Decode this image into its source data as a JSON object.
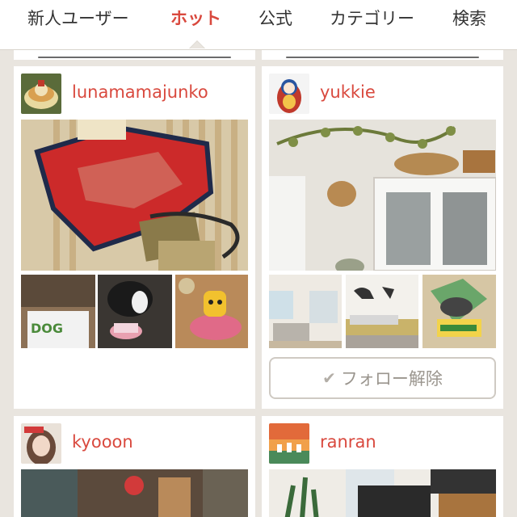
{
  "tabs": [
    {
      "label": "新人ユーザー",
      "active": false
    },
    {
      "label": "ホット",
      "active": true
    },
    {
      "label": "公式",
      "active": false
    },
    {
      "label": "カテゴリー",
      "active": false
    },
    {
      "label": "検索",
      "active": false
    }
  ],
  "colors": {
    "accent": "#d9493e",
    "background": "#e9e5df",
    "card": "#ffffff"
  },
  "cards": [
    {
      "username": "lunamamajunko",
      "avatar_icon": "cake-avatar",
      "has_follow_button": false
    },
    {
      "username": "yukkie",
      "avatar_icon": "matryoshka-avatar",
      "follow_button": {
        "icon": "check-icon",
        "label": "フォロー解除"
      }
    },
    {
      "username": "kyooon",
      "avatar_icon": "girl-portrait-avatar"
    },
    {
      "username": "ranran",
      "avatar_icon": "landscape-avatar"
    }
  ]
}
